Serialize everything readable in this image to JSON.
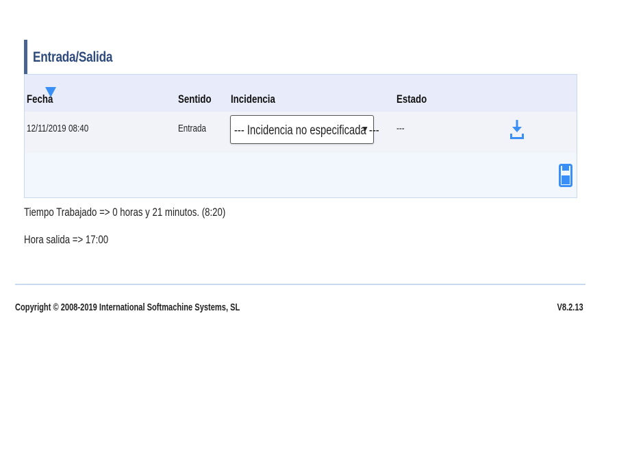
{
  "section": {
    "title": "Entrada/Salida"
  },
  "table": {
    "columns": {
      "fecha": "Fecha",
      "sentido": "Sentido",
      "incidencia": "Incidencia",
      "estado": "Estado"
    },
    "rows": [
      {
        "fecha": "12/11/2019 08:40",
        "sentido": "Entrada",
        "incidencia": "--- Incidencia no especificada ---",
        "estado": "---"
      }
    ]
  },
  "summary": {
    "tiempo_trabajado": "Tiempo Trabajado => 0 horas y 21 minutos. (8:20)",
    "hora_salida": "Hora salida => 17:00"
  },
  "footer": {
    "copyright": "Copyright © 2008-2019 International Softmachine Systems, SL",
    "version": "V8.2.13"
  },
  "icons": {
    "sort": "sort-descending-icon",
    "download": "download-icon",
    "save": "save-icon",
    "caret": "chevron-down-icon"
  },
  "colors": {
    "accent": "#4a6491",
    "title": "#2e4a7d",
    "icon_blue": "#3a8ff7",
    "header_bg": "#e8ebfa",
    "row_bg": "#f1f3f8",
    "panel_border": "#c9daf0"
  }
}
